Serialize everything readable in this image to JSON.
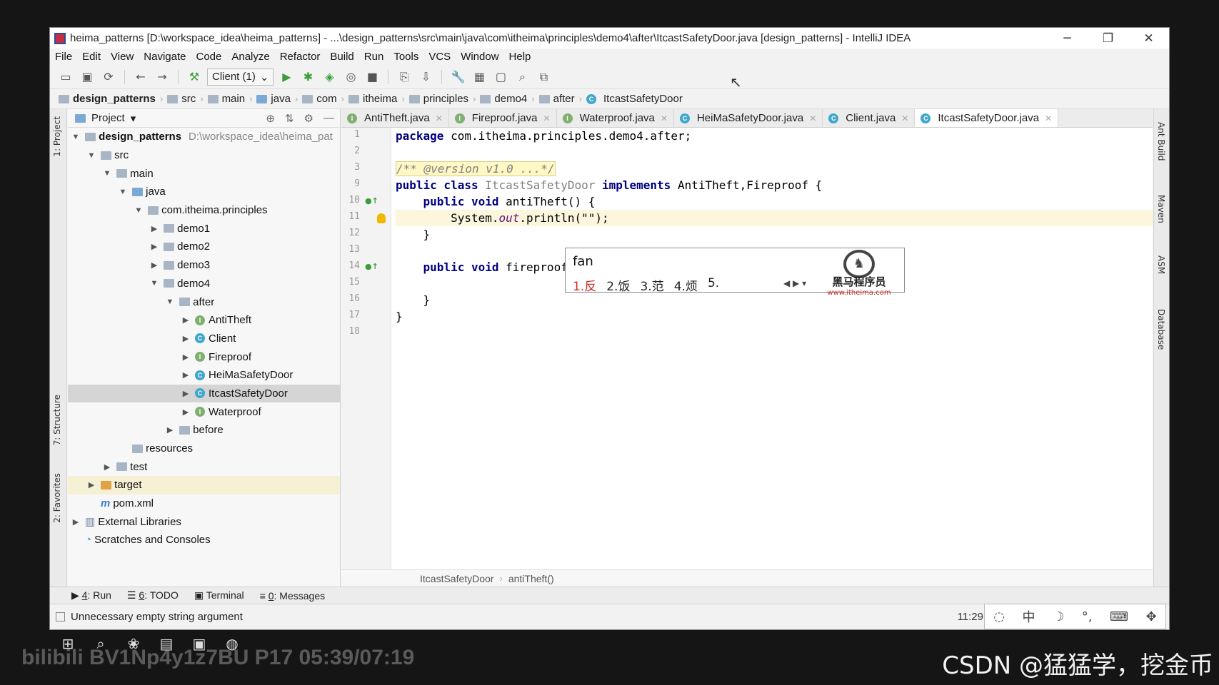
{
  "window": {
    "title": "heima_patterns [D:\\workspace_idea\\heima_patterns] - ...\\design_patterns\\src\\main\\java\\com\\itheima\\principles\\demo4\\after\\ItcastSafetyDoor.java [design_patterns] - IntelliJ IDEA",
    "minimize": "─",
    "restore": "❐",
    "close": "✕"
  },
  "menu": [
    "File",
    "Edit",
    "View",
    "Navigate",
    "Code",
    "Analyze",
    "Refactor",
    "Build",
    "Run",
    "Tools",
    "VCS",
    "Window",
    "Help"
  ],
  "toolbar": {
    "run_config": "Client (1)"
  },
  "breadcrumbs": [
    "design_patterns",
    "src",
    "main",
    "java",
    "com",
    "itheima",
    "principles",
    "demo4",
    "after",
    "ItcastSafetyDoor"
  ],
  "side_left": {
    "project": "1: Project",
    "structure": "7: Structure",
    "favorites": "2: Favorites"
  },
  "side_right": {
    "ant": "Ant Build",
    "maven": "Maven",
    "asm": "ASM",
    "database": "Database"
  },
  "project_panel": {
    "title": "Project",
    "tree": [
      {
        "label": "design_patterns",
        "path": "D:\\workspace_idea\\heima_pat",
        "icon": "module"
      },
      {
        "label": "src",
        "icon": "folder"
      },
      {
        "label": "main",
        "icon": "folder"
      },
      {
        "label": "java",
        "icon": "folder-blue"
      },
      {
        "label": "com.itheima.principles",
        "icon": "package"
      },
      {
        "label": "demo1",
        "icon": "package"
      },
      {
        "label": "demo2",
        "icon": "package"
      },
      {
        "label": "demo3",
        "icon": "package"
      },
      {
        "label": "demo4",
        "icon": "package"
      },
      {
        "label": "after",
        "icon": "package"
      },
      {
        "label": "AntiTheft",
        "icon": "interface"
      },
      {
        "label": "Client",
        "icon": "class"
      },
      {
        "label": "Fireproof",
        "icon": "interface"
      },
      {
        "label": "HeiMaSafetyDoor",
        "icon": "class"
      },
      {
        "label": "ItcastSafetyDoor",
        "icon": "class"
      },
      {
        "label": "Waterproof",
        "icon": "interface"
      },
      {
        "label": "before",
        "icon": "package"
      },
      {
        "label": "resources",
        "icon": "folder"
      },
      {
        "label": "test",
        "icon": "folder"
      },
      {
        "label": "target",
        "icon": "folder-orange"
      },
      {
        "label": "pom.xml",
        "icon": "maven"
      },
      {
        "label": "External Libraries",
        "icon": "library"
      },
      {
        "label": "Scratches and Consoles",
        "icon": "scratch"
      }
    ]
  },
  "tabs": [
    {
      "label": "AntiTheft.java",
      "icon": "interface"
    },
    {
      "label": "Fireproof.java",
      "icon": "interface"
    },
    {
      "label": "Waterproof.java",
      "icon": "interface"
    },
    {
      "label": "HeiMaSafetyDoor.java",
      "icon": "class"
    },
    {
      "label": "Client.java",
      "icon": "class"
    },
    {
      "label": "ItcastSafetyDoor.java",
      "icon": "class",
      "active": true
    }
  ],
  "editor": {
    "line_numbers": [
      "1",
      "2",
      "3",
      "9",
      "10",
      "11",
      "12",
      "13",
      "14",
      "15",
      "16",
      "17",
      "18"
    ],
    "lines": {
      "l1_kw": "package",
      "l1_rest": " com.itheima.principles.demo4.after;",
      "l3_fold": "/** @version v1.0 ...*/",
      "l9_kw1": "public class",
      "l9_cls": " ItcastSafetyDoor ",
      "l9_kw2": "implements",
      "l9_rest": " AntiTheft,Fireproof {",
      "l10_kw": "    public void",
      "l10_rest": " antiTheft() {",
      "l11_a": "        System.",
      "l11_out": "out",
      "l11_b": ".println(\"\");",
      "l12": "    }",
      "l14_kw": "    public void",
      "l14_rest": " fireproof()",
      "l16": "    }",
      "l17": "}"
    },
    "breadcrumb": [
      "ItcastSafetyDoor",
      "antiTheft()"
    ]
  },
  "ime_popup": {
    "composition": "fan",
    "candidates": [
      "1.反",
      "2.饭",
      "3.范",
      "4.烦",
      "5."
    ],
    "brand": "黑马程序员",
    "url": "www.itheima.com"
  },
  "bottom_tools": [
    {
      "num": "4",
      "label": ": Run"
    },
    {
      "num": "6",
      "label": ": TODO"
    },
    {
      "num": "",
      "label": "Terminal"
    },
    {
      "num": "0",
      "label": ": Messages"
    }
  ],
  "status": {
    "message": "Unnecessary empty string argument",
    "time": "11:29"
  },
  "taskbar": {
    "watermark": "bilibili BV1Np4y1z7BU P17 05:39/07:19",
    "credit": "CSDN @猛猛学，挖金币"
  }
}
